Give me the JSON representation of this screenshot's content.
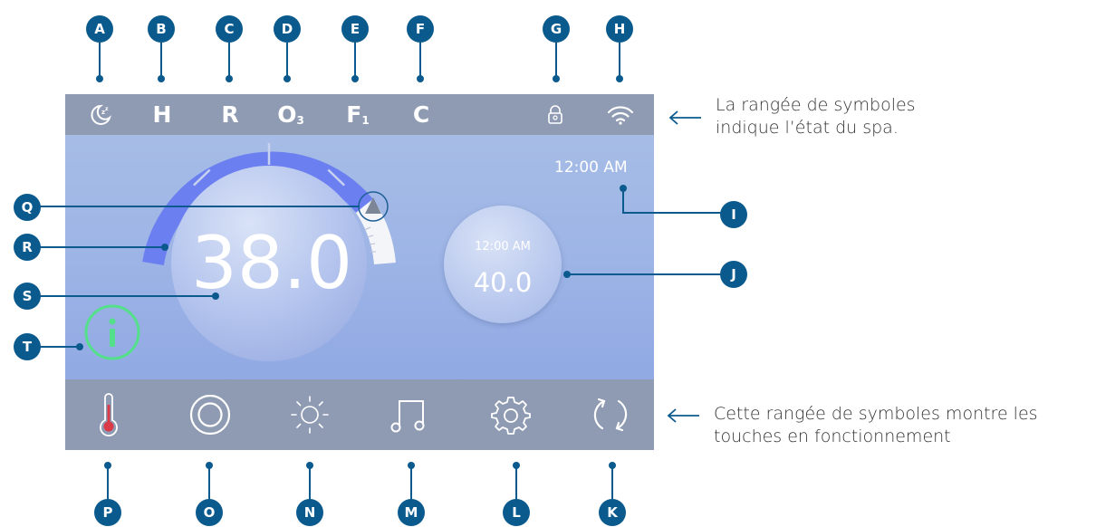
{
  "markers": {
    "top": [
      "A",
      "B",
      "C",
      "D",
      "E",
      "F",
      "G",
      "H"
    ],
    "right": [
      "I",
      "J"
    ],
    "bottom": [
      "P",
      "O",
      "N",
      "M",
      "L",
      "K"
    ],
    "left": [
      "T",
      "S",
      "R",
      "Q"
    ]
  },
  "status_bar": {
    "symbols": [
      {
        "icon": "sleep-mode-icon"
      },
      {
        "text": "H"
      },
      {
        "text": "R"
      },
      {
        "text": "O",
        "sub": "3"
      },
      {
        "text": "F",
        "sub": "1"
      },
      {
        "text": "C"
      },
      {
        "icon": "lock-icon"
      },
      {
        "icon": "wifi-icon"
      }
    ]
  },
  "screen": {
    "time": "12:00 AM",
    "main_temperature": "38.0",
    "set_point": {
      "time": "12:00 AM",
      "temperature": "40.0"
    },
    "info_icon": "info-icon",
    "arc_level": 0.78
  },
  "button_bar": {
    "icons": [
      "thermometer-icon",
      "pump-icon",
      "light-icon",
      "music-icon",
      "settings-gear-icon",
      "refresh-icon"
    ]
  },
  "annotations": {
    "status": [
      "La rangée de symboles",
      "indique l’état du spa."
    ],
    "buttons": [
      "Cette rangée de symboles montre les",
      "touches en fonctionnement"
    ]
  },
  "colors": {
    "marker": "#0b5a8e",
    "arc": "#6b7ff0",
    "info_ring": "#54e08a",
    "thermo_red": "#d93b48"
  }
}
